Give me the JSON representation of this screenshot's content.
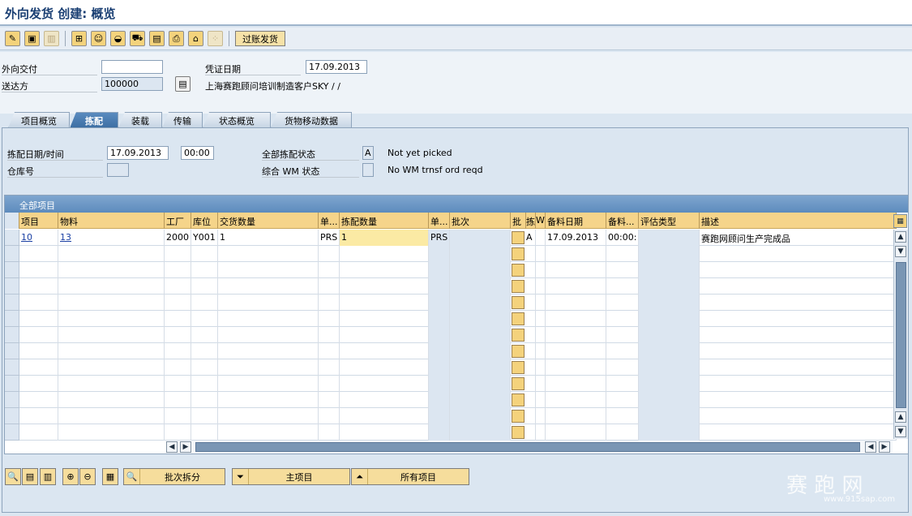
{
  "title": "外向发货 创建: 概览",
  "toolbar": {
    "post_label": "过账发货",
    "icons": [
      "edit-icon",
      "display-icon",
      "delete-icon",
      "header-icon",
      "partner-icon",
      "hat-icon",
      "truck-icon",
      "package-icon",
      "print-icon",
      "shipment-icon",
      "batch-icon"
    ]
  },
  "header": {
    "outbound_delivery_label": "外向交付",
    "outbound_delivery_value": "",
    "doc_date_label": "凭证日期",
    "doc_date_value": "17.09.2013",
    "ship_to_label": "送达方",
    "ship_to_value": "100000",
    "ship_to_name": "上海赛跑顾问培训制造客户SKY / /"
  },
  "tabs": [
    {
      "label": "项目概览",
      "active": false
    },
    {
      "label": "拣配",
      "active": true
    },
    {
      "label": "装载",
      "active": false
    },
    {
      "label": "传输",
      "active": false
    },
    {
      "label": "状态概览",
      "active": false
    },
    {
      "label": "货物移动数据",
      "active": false
    }
  ],
  "picking": {
    "pick_date_label": "拣配日期/时间",
    "pick_date_value": "17.09.2013",
    "pick_time_value": "00:00",
    "warehouse_label": "仓库号",
    "warehouse_value": "",
    "overall_pick_status_label": "全部拣配状态",
    "overall_pick_status_code": "A",
    "overall_pick_status_text": "Not yet picked",
    "wm_status_label": "综合 WM 状态",
    "wm_status_code": "",
    "wm_status_text": "No WM trnsf ord reqd"
  },
  "grid": {
    "title": "全部项目",
    "columns": [
      "项目",
      "物料",
      "工厂",
      "库位",
      "交货数量",
      "单...",
      "拣配数量",
      "单...",
      "批次",
      "批",
      "拣",
      "W",
      "备料日期",
      "备料...",
      "评估类型",
      "描述"
    ],
    "rows": [
      {
        "item": "10",
        "material": "13",
        "plant": "2000",
        "sloc": "Y001",
        "deliv_qty": "1",
        "unit": "PRS",
        "pick_qty": "1",
        "unit2": "PRS",
        "batch": "",
        "pick_status": "A",
        "wm": "",
        "mat_date": "17.09.2013",
        "mat_time": "00:00:",
        "val_type": "",
        "description": "赛跑网顾问生产完成品"
      }
    ],
    "empty_rows": 12
  },
  "bottom": {
    "batch_split_label": "批次拆分",
    "main_items_label": "主项目",
    "all_items_label": "所有项目"
  },
  "watermark": {
    "text": "赛 跑 网",
    "url": "www.915sap.com"
  }
}
